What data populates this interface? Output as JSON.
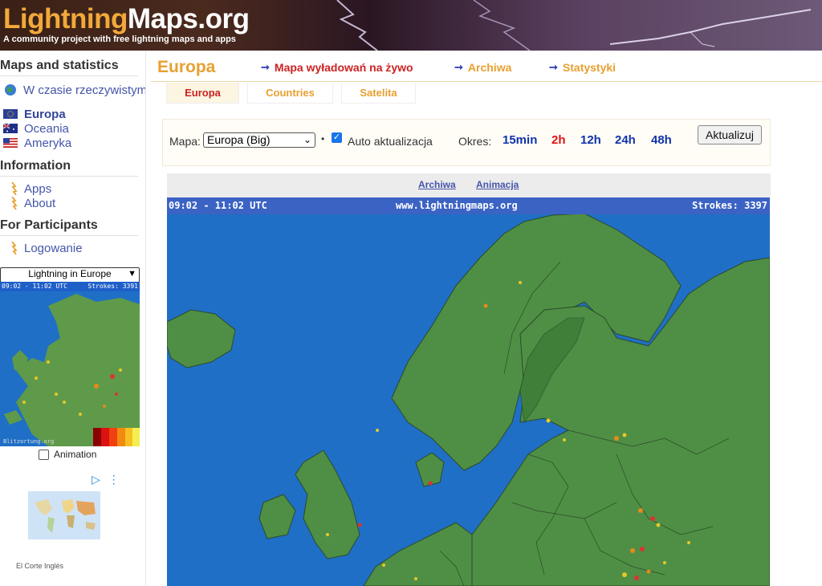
{
  "header": {
    "logo_part1": "Lightning",
    "logo_part2": "Maps.org",
    "tagline": "A community project with free lightning maps and apps"
  },
  "sidebar": {
    "maps_heading": "Maps and statistics",
    "realtime_label": "W czasie rzeczywistym",
    "regions": [
      {
        "label": "Europa"
      },
      {
        "label": "Oceania"
      },
      {
        "label": "Ameryka"
      }
    ],
    "information_heading": "Information",
    "info_links": [
      {
        "label": "Apps"
      },
      {
        "label": "About"
      }
    ],
    "participants_heading": "For Participants",
    "login_label": "Logowanie",
    "mini_select_value": "Lightning in Europe",
    "mini_map_time": "09:02 - 11:02 UTC",
    "mini_map_strokes": "Strokes: 3391",
    "mini_map_footer": "Blitzortung.org",
    "animation_label": "Animation",
    "ad_label": "El Corte Inglés"
  },
  "main": {
    "title": "Europa",
    "nav": [
      {
        "label": "Mapa wyładowań na żywo",
        "color": "#cc2222"
      },
      {
        "label": "Archiwa",
        "color": "#e8a030"
      },
      {
        "label": "Statystyki",
        "color": "#e8a030"
      }
    ],
    "tabs": [
      {
        "label": "Europa",
        "active": true
      },
      {
        "label": "Countries",
        "active": false
      },
      {
        "label": "Satelita",
        "active": false
      }
    ],
    "controls": {
      "map_label": "Mapa:",
      "map_value": "Europa (Big)",
      "auto_update_label": "Auto aktualizacja",
      "auto_update_checked": true,
      "period_label": "Okres:",
      "periods": [
        {
          "label": "15min",
          "active": false
        },
        {
          "label": "2h",
          "active": true
        },
        {
          "label": "12h",
          "active": false
        },
        {
          "label": "24h",
          "active": false
        },
        {
          "label": "48h",
          "active": false
        }
      ],
      "update_button": "Aktualizuj"
    },
    "map_links": [
      "Archiwa",
      "Animacja"
    ],
    "map_overlay": {
      "time_range": "09:02 - 11:02 UTC",
      "site": "www.lightningmaps.org",
      "strokes": "Strokes: 3397"
    }
  },
  "colors": {
    "accent_orange": "#e8a030",
    "link_blue": "#4455aa",
    "active_red": "#cc2222",
    "sea": "#1f6fc6",
    "land": "#4f8f45"
  }
}
